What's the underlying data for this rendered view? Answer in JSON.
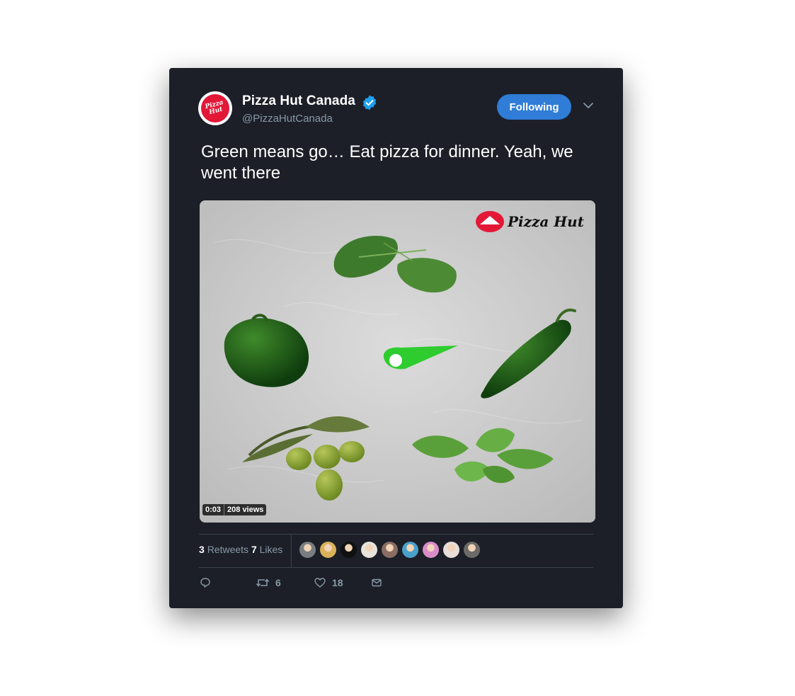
{
  "account": {
    "name": "Pizza Hut Canada",
    "handle": "@PizzaHutCanada",
    "avatar_logo": "Pizza Hut",
    "verified_icon": "verified-badge-icon"
  },
  "follow_button": {
    "label": "Following"
  },
  "menu_icon": "chevron-down-icon",
  "tweet": {
    "text": "Green means go… Eat pizza for dinner. Yeah, we went there"
  },
  "media": {
    "watermark": "Pizza Hut",
    "duration": "0:03",
    "views": "208 views"
  },
  "engagement": {
    "retweets_count": "3",
    "retweets_label": "Retweets",
    "likes_count": "7",
    "likes_label": "Likes",
    "liker_avatar_colors": [
      "#7a7d80",
      "#d9b25a",
      "#111111",
      "#e8e4dc",
      "#8a6e63",
      "#4aa0c8",
      "#d98cc8",
      "#e9ddd8",
      "#6c6a66"
    ]
  },
  "actions": {
    "reply": {
      "icon": "reply-icon",
      "count": ""
    },
    "retweet": {
      "icon": "retweet-icon",
      "count": "6"
    },
    "like": {
      "icon": "heart-icon",
      "count": "18"
    },
    "dm": {
      "icon": "envelope-icon",
      "count": ""
    }
  },
  "colors": {
    "card_bg": "#1c1f28",
    "accent": "#2f7dd6",
    "verified": "#1da1f2",
    "muted": "#8899a6",
    "brand_red": "#e31837"
  }
}
